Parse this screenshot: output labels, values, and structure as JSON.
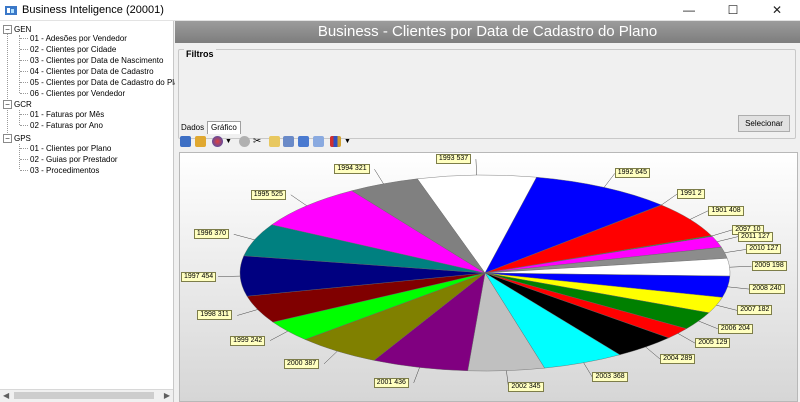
{
  "window": {
    "title": "Business Inteligence (20001)",
    "minimize": "—",
    "maximize": "☐",
    "close": "✕"
  },
  "tree": [
    {
      "label": "GEN",
      "children": [
        "01 - Adesões por Vendedor",
        "02 - Clientes por Cidade",
        "03 - Clientes por Data de Nascimento",
        "04 - Clientes por Data de Cadastro",
        "05 - Clientes por Data de Cadastro do Plano",
        "06 - Clientes por Vendedor"
      ]
    },
    {
      "label": "GCR",
      "children": [
        "01 - Faturas por Mês",
        "02 - Faturas por Ano"
      ]
    },
    {
      "label": "GPS",
      "children": [
        "01 - Clientes por Plano",
        "02 - Guias por Prestador",
        "03 - Procedimentos"
      ]
    }
  ],
  "header": {
    "title": "Business - Clientes por Data de Cadastro do Plano"
  },
  "filters": {
    "label": "Filtros",
    "select_button": "Selecionar"
  },
  "tabs": {
    "dados": "Dados",
    "grafico": "Gráfico"
  },
  "toolbar_icons": [
    "open-icon",
    "folder-icon",
    "palette-icon",
    "dropdown-icon",
    "3d-icon",
    "scissors-icon",
    "copy-icon",
    "grid-icon",
    "bar-chart-icon",
    "zoom-icon",
    "chart-type-icon",
    "dropdown-icon"
  ],
  "chart_data": {
    "type": "pie",
    "slices": [
      {
        "label": "1993",
        "value": 537,
        "color": "#ffffff"
      },
      {
        "label": "1992",
        "value": 645,
        "color": "#0000ff"
      },
      {
        "label": "1991",
        "value": 2,
        "color": "#000000"
      },
      {
        "label": "1901",
        "value": 408,
        "color": "#ff0000"
      },
      {
        "label": "2097",
        "value": 10,
        "color": "#00c000"
      },
      {
        "label": "2011",
        "value": 127,
        "color": "#ff00ff"
      },
      {
        "label": "2010",
        "value": 127,
        "color": "#8c8c8c"
      },
      {
        "label": "2009",
        "value": 198,
        "color": "#ffffff"
      },
      {
        "label": "2008",
        "value": 240,
        "color": "#0000ff"
      },
      {
        "label": "2007",
        "value": 182,
        "color": "#ffff00"
      },
      {
        "label": "2006",
        "value": 204,
        "color": "#008000"
      },
      {
        "label": "2005",
        "value": 129,
        "color": "#ff0000"
      },
      {
        "label": "2004",
        "value": 289,
        "color": "#000000"
      },
      {
        "label": "2003",
        "value": 368,
        "color": "#00ffff"
      },
      {
        "label": "2002",
        "value": 345,
        "color": "#c0c0c0"
      },
      {
        "label": "2001",
        "value": 436,
        "color": "#800080"
      },
      {
        "label": "2000",
        "value": 387,
        "color": "#808000"
      },
      {
        "label": "1999",
        "value": 242,
        "color": "#00ff00"
      },
      {
        "label": "1998",
        "value": 311,
        "color": "#800000"
      },
      {
        "label": "1997",
        "value": 454,
        "color": "#000080"
      },
      {
        "label": "1996",
        "value": 370,
        "color": "#008080"
      },
      {
        "label": "1995",
        "value": 525,
        "color": "#ff00ff"
      },
      {
        "label": "1994",
        "value": 321,
        "color": "#808080"
      }
    ],
    "labels": [
      "1993 537",
      "1992 645",
      "1991 2",
      "1901 408",
      "2097 10",
      "2011 127",
      "2010 127",
      "2009 198",
      "2008 240",
      "2007 182",
      "2006 204",
      "2005 129",
      "2004 289",
      "2003 368",
      "2002 345",
      "2001 436",
      "2000 387",
      "1999 242",
      "1998 311",
      "1997 454",
      "1996 370",
      "1995 525",
      "1994 321"
    ]
  }
}
